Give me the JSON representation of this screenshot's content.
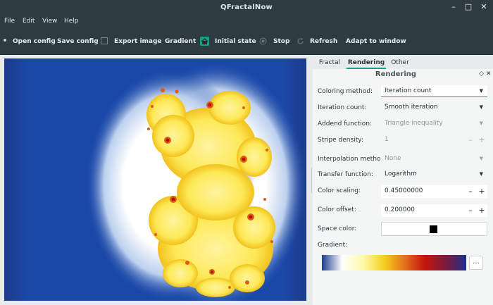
{
  "window": {
    "title": "QFractalNow"
  },
  "menu": [
    "File",
    "Edit",
    "View",
    "Help"
  ],
  "toolbar": {
    "open_config": "Open config",
    "save_config": "Save config",
    "export_image": "Export image",
    "gradient": "Gradient",
    "initial_state": "Initial state",
    "stop": "Stop",
    "refresh": "Refresh",
    "adapt": "Adapt to window"
  },
  "tabs": [
    "Fractal",
    "Rendering",
    "Other"
  ],
  "active_tab": "Rendering",
  "pane": {
    "title": "Rendering"
  },
  "rendering": {
    "coloring_method": {
      "label": "Coloring method:",
      "value": "Iteration count"
    },
    "iteration_count": {
      "label": "Iteration count:",
      "value": "Smooth iteration"
    },
    "addend_function": {
      "label": "Addend function:",
      "value": "Triangle inequality"
    },
    "stripe_density": {
      "label": "Stripe density:",
      "value": "1"
    },
    "interpolation": {
      "label": "Interpolation method:",
      "value": "None"
    },
    "transfer_function": {
      "label": "Transfer function:",
      "value": "Logarithm"
    },
    "color_scaling": {
      "label": "Color scaling:",
      "value": "0.45000000"
    },
    "color_offset": {
      "label": "Color offset:",
      "value": "0.200000"
    },
    "space_color": {
      "label": "Space color:",
      "color": "#000000"
    },
    "gradient": {
      "label": "Gradient:",
      "more": "..."
    }
  },
  "colors": {
    "accent": "#16a085",
    "chrome": "#2e3b40",
    "gradient_stops": [
      "#1d3b8f",
      "#ffffff",
      "#fff9a8",
      "#f5d020",
      "#e5731c",
      "#c4160c",
      "#7a1a3d",
      "#1f2f8a"
    ]
  }
}
